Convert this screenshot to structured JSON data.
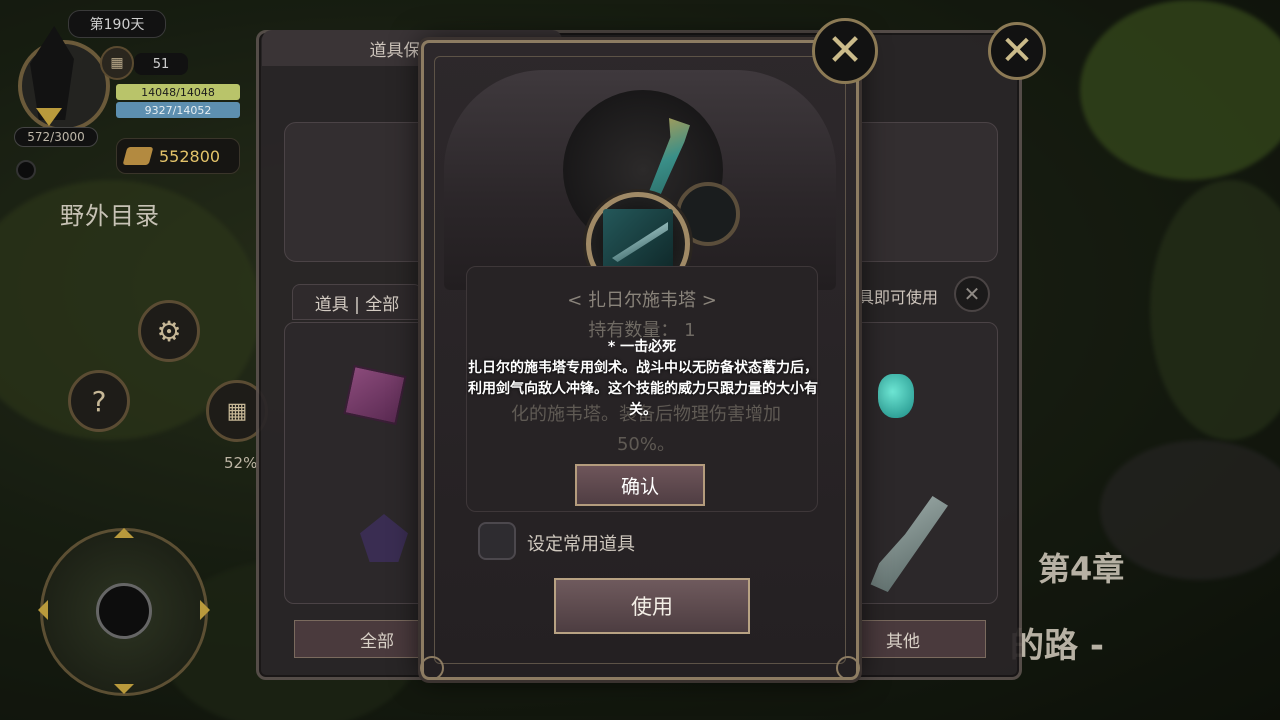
{
  "hud": {
    "day": "第190天",
    "level": "51",
    "energy": "572/3000",
    "hp": "14048/14048",
    "mp": "9327/14052",
    "gold": "552800",
    "field_menu": "野外目录",
    "percent": "52%",
    "help_symbol": "?"
  },
  "background": {
    "chapter": "第4章",
    "road_text": "的路 -"
  },
  "storage": {
    "title": "道具保管箱",
    "filter_tab": "道具 | 全部",
    "use_hint": "具即可使用",
    "bottom_tabs": [
      "全部",
      "其他"
    ]
  },
  "dialog": {
    "item_name": "< 扎日尔施韦塔 >",
    "quantity_text": "持有数量：  1",
    "faint_desc": "化的施韦塔。装备后物理伤害增加50%。",
    "tooltip_title": "* 一击必死",
    "tooltip_body": "扎日尔的施韦塔专用剑术。战斗中以无防备状态蓄力后，利用剑气向敌人冲锋。这个技能的威力只跟力量的大小有关。",
    "confirm_label": "确认",
    "favorite_label": "设定常用道具",
    "use_label": "使用"
  },
  "icons": {
    "close": "close-x-icon",
    "calendar": "calendar-icon",
    "gear": "gear-icon",
    "gold": "gold-ingot-icon",
    "crystal": "crystal-icon"
  },
  "colors": {
    "accent_gold": "#8d7c62",
    "hp": "#b9c46a",
    "mp": "#5d8fb0",
    "gold_text": "#e3c36a"
  }
}
